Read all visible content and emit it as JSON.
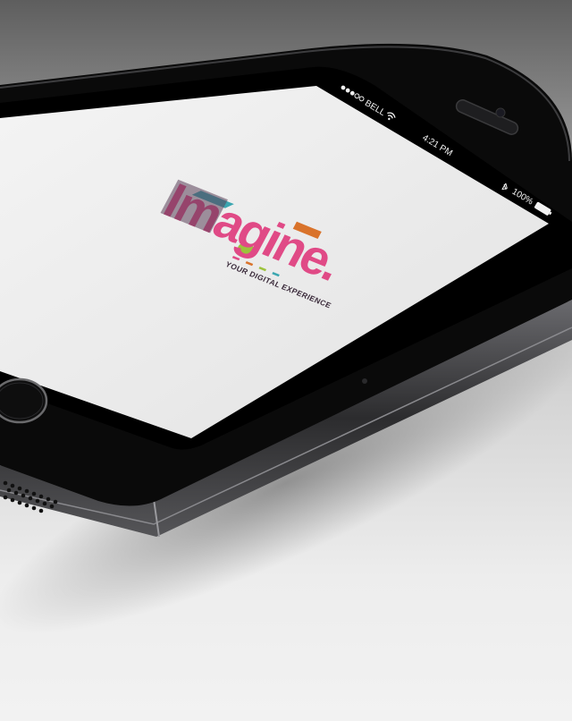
{
  "status_bar": {
    "carrier": "BELL",
    "time": "4:21 PM",
    "battery": "100%",
    "signal_icon": "signal-dots-icon",
    "wifi_icon": "wifi-icon",
    "bluetooth_icon": "bluetooth-icon",
    "battery_icon": "battery-icon"
  },
  "splash": {
    "logo_text": "Imagine.",
    "tagline": "YOUR DIGITAL EXPERIENCE"
  },
  "colors": {
    "logo_pink": "#e04a86",
    "logo_plum": "#5a3f57",
    "logo_teal": "#3aa6b0",
    "logo_orange": "#d9732b",
    "logo_green": "#9cc33c",
    "phone_body": "#0a0a0a",
    "phone_metal": "#4a4a4d"
  }
}
